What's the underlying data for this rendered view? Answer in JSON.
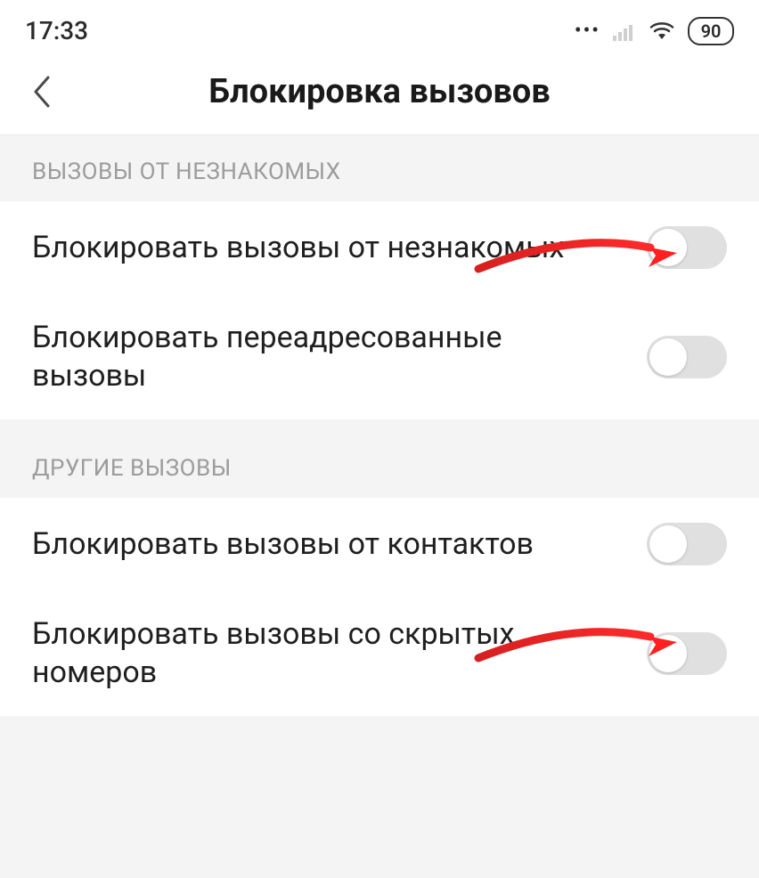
{
  "statusbar": {
    "time": "17:33",
    "battery": "90"
  },
  "header": {
    "title": "Блокировка вызовов"
  },
  "sections": [
    {
      "header": "ВЫЗОВЫ ОТ НЕЗНАКОМЫХ",
      "items": [
        {
          "label": "Блокировать вызовы от незнакомых"
        },
        {
          "label": "Блокировать переадресованные вызовы"
        }
      ]
    },
    {
      "header": "ДРУГИЕ ВЫЗОВЫ",
      "items": [
        {
          "label": "Блокировать вызовы от контактов"
        },
        {
          "label": "Блокировать вызовы со скрытых номеров"
        }
      ]
    }
  ]
}
